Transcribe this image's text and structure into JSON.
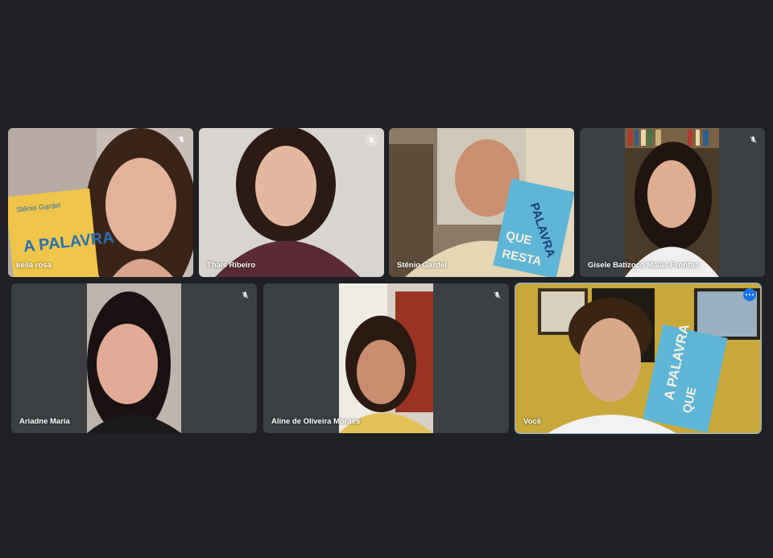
{
  "participants": [
    {
      "name": "keila rosa",
      "mic": "muted"
    },
    {
      "name": "Thaís Ribeiro",
      "mic": "muted"
    },
    {
      "name": "Stênio Gardel",
      "mic": "muted"
    },
    {
      "name": "Gisele Batizoco Malas Prontas",
      "mic": "muted"
    },
    {
      "name": "Ariadne Maria",
      "mic": "muted"
    },
    {
      "name": "Aline de Oliveira Moraes",
      "mic": "muted"
    },
    {
      "name": "Você",
      "mic": "on",
      "self": true
    }
  ],
  "book": {
    "author": "Stênio Gardel",
    "title_line1": "A PALAVRA",
    "title_line2": "QUE",
    "title_line3": "RESTA"
  },
  "icons": {
    "mic_off": "mic-off-icon",
    "more_options": "more-options-icon"
  },
  "colors": {
    "background": "#202124",
    "tile": "#3c4043",
    "active_outline": "#8ab4f8",
    "more_button": "#1a73e8"
  }
}
